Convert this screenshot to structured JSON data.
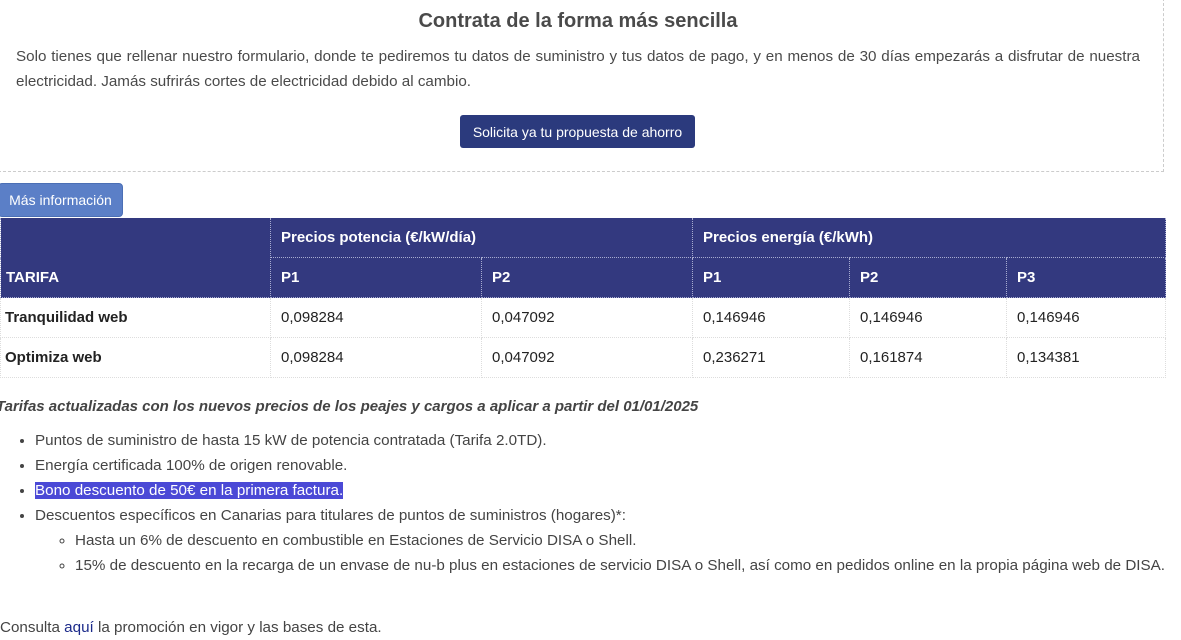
{
  "contract": {
    "title": "Contrata de la forma más sencilla",
    "text": "Solo tienes que rellenar nuestro formulario, donde te pediremos tu datos de suministro y tus datos de pago, y en menos de 30 días empezarás a disfrutar de nuestra electricidad. Jamás sufrirás cortes de electricidad debido al cambio.",
    "button_label": "Solicita ya tu propuesta de ahorro"
  },
  "more_info_label": "Más información",
  "table": {
    "tarifa_header": "TARIFA",
    "group_power": "Precios potencia (€/kW/día)",
    "group_energy": "Precios energía (€/kWh)",
    "sub_headers": [
      "P1",
      "P2",
      "P1",
      "P2",
      "P3"
    ],
    "rows": [
      {
        "name": "Tranquilidad web",
        "values": [
          "0,098284",
          "0,047092",
          "0,146946",
          "0,146946",
          "0,146946"
        ]
      },
      {
        "name": "Optimiza web",
        "values": [
          "0,098284",
          "0,047092",
          "0,236271",
          "0,161874",
          "0,134381"
        ]
      }
    ]
  },
  "updated_note": "Tarifas actualizadas con los nuevos precios de los peajes y cargos a aplicar a partir del 01/01/2025",
  "features": {
    "items": [
      "Puntos de suministro de hasta 15 kW de potencia contratada (Tarifa 2.0TD).",
      "Energía certificada 100% de origen renovable.",
      "Bono descuento de 50€ en la primera factura.",
      "Descuentos específicos en Canarias para titulares de puntos de suministros (hogares)*:"
    ],
    "sub_items": [
      "Hasta un 6% de descuento en combustible en Estaciones de Servicio DISA o Shell.",
      "15% de descuento en la recarga de un envase de nu-b plus en estaciones de servicio DISA o Shell, así como en pedidos online en la propia página web de DISA."
    ]
  },
  "consult": {
    "before": "Consulta ",
    "link": "aquí",
    "after": " la promoción en vigor y las bases de esta."
  },
  "colors": {
    "header_bg": "#33397f",
    "primary_button": "#2b3a7d",
    "info_button": "#5b7fc7",
    "highlight": "#4b49d6"
  }
}
